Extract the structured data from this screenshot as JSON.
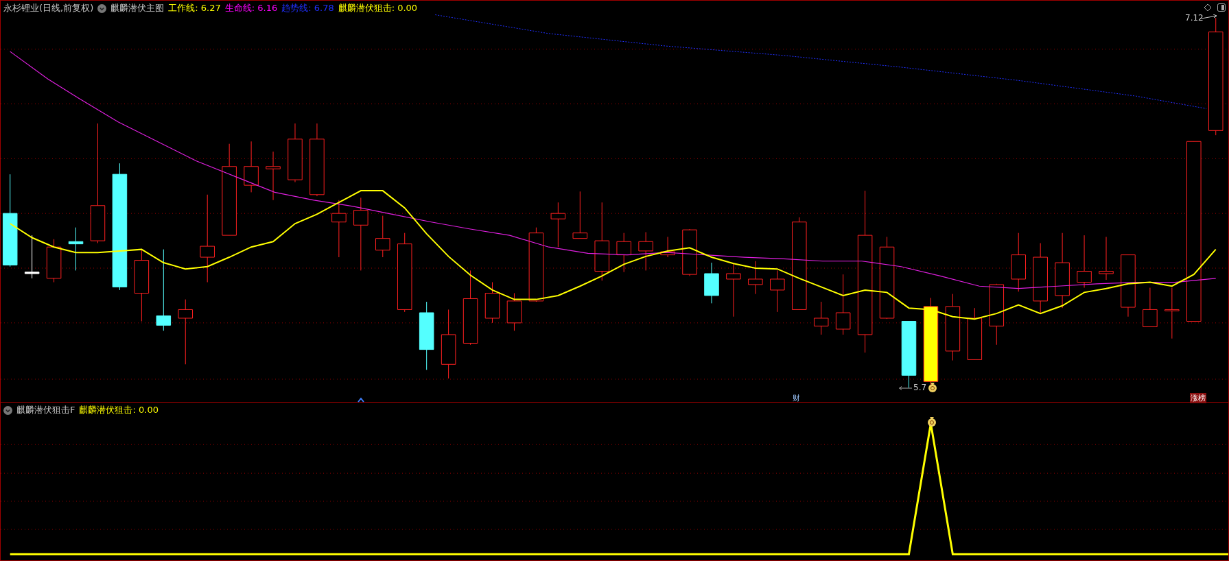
{
  "main_chart": {
    "stock_title": "永杉锂业(日线,前复权)",
    "indicator_name": "麒麟潜伏主图",
    "indicators": [
      {
        "label": "工作线:",
        "value": "6.27",
        "color": "#ffff00"
      },
      {
        "label": "生命线:",
        "value": "6.16",
        "color": "#ff00ff"
      },
      {
        "label": "趋势线:",
        "value": "6.78",
        "color": "#2030ff"
      },
      {
        "label": "麒麟潜伏狙击:",
        "value": "0.00",
        "color": "#ffff00"
      }
    ],
    "high_label": "7.12",
    "low_label": "5.7",
    "markers": [
      {
        "text": "财",
        "kind": "finance"
      },
      {
        "text": "涨榜",
        "kind": "rank"
      }
    ]
  },
  "sub_chart": {
    "title": "麒麟潜伏狙击F",
    "indicator": {
      "label": "麒麟潜伏狙击:",
      "value": "0.00",
      "color": "#ffff00"
    }
  }
}
